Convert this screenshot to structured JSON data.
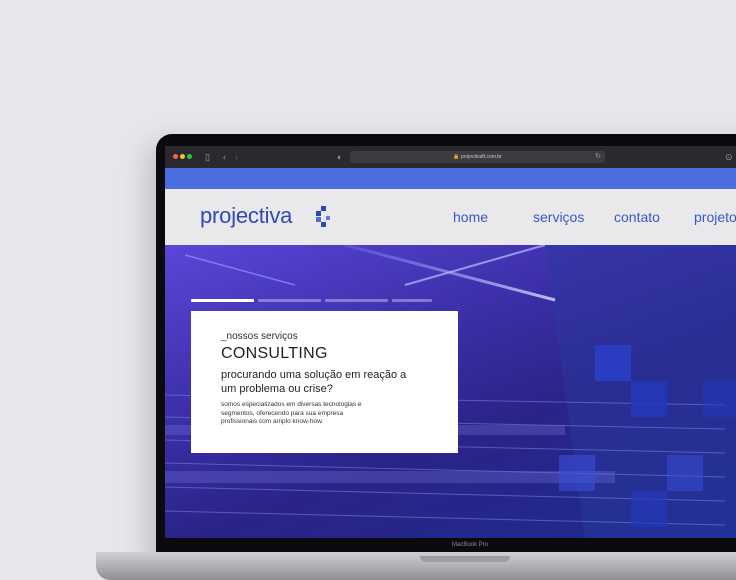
{
  "browser": {
    "url": "projectivaft.com.br",
    "lock_icon": "lock-icon",
    "reload_icon": "reload-icon",
    "sidebar_icon": "sidebar-icon",
    "shield_icon": "shield-icon"
  },
  "site": {
    "logo": "projectiva",
    "nav": {
      "home": "home",
      "services": "serviços",
      "contact": "contato",
      "projects": "projetos"
    }
  },
  "hero": {
    "slides_count": 4,
    "active_slide": 1,
    "card": {
      "eyebrow": "_nossos serviços",
      "title": "CONSULTING",
      "question": "procurando uma solução em reação a um problema ou crise?",
      "description": "somos especializados em diversas tecnologias e segmentos, oferecendo para sua empresa profissionais com amplo know-how."
    }
  },
  "device": {
    "label": "MacBook Pro"
  },
  "colors": {
    "brand_blue": "#3048b8",
    "nav_blue": "#3a57c9",
    "strip_blue": "#4a6ee0",
    "hero_violet": "#5a46d8"
  }
}
